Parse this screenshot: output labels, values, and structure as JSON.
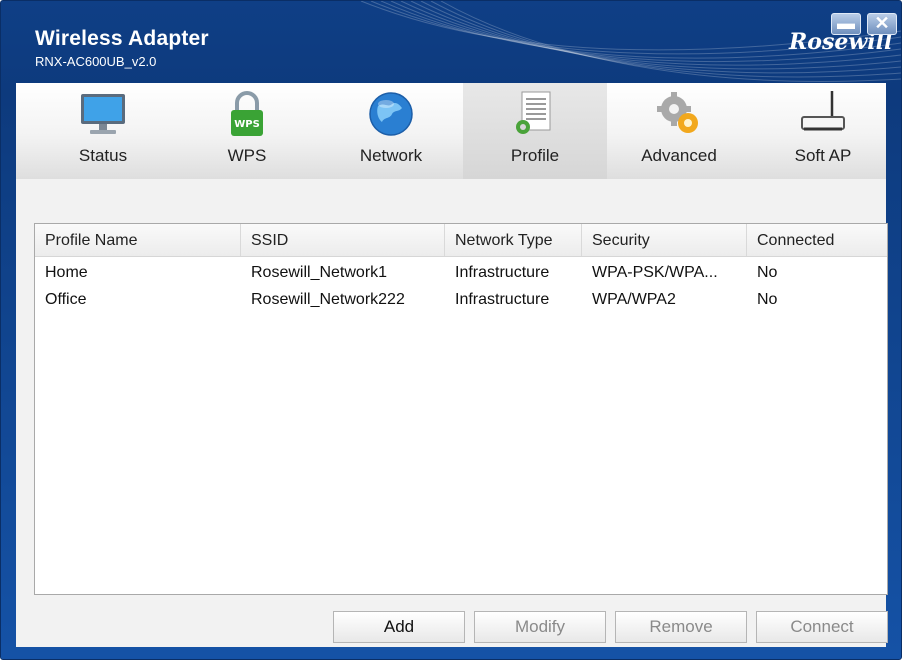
{
  "window": {
    "title": "Wireless Adapter",
    "subtitle": "RNX-AC600UB_v2.0",
    "logo": "Rosewill",
    "minimize_icon": "minimize-icon",
    "close_icon": "close-icon"
  },
  "tabs": [
    {
      "label": "Status",
      "icon": "monitor-icon",
      "active": false
    },
    {
      "label": "WPS",
      "icon": "wps-lock-icon",
      "active": false
    },
    {
      "label": "Network",
      "icon": "globe-icon",
      "active": false
    },
    {
      "label": "Profile",
      "icon": "document-gear-icon",
      "active": true
    },
    {
      "label": "Advanced",
      "icon": "gears-icon",
      "active": false
    },
    {
      "label": "Soft AP",
      "icon": "router-icon",
      "active": false
    }
  ],
  "profile_table": {
    "columns": [
      "Profile Name",
      "SSID",
      "Network Type",
      "Security",
      "Connected"
    ],
    "rows": [
      [
        "Home",
        "Rosewill_Network1",
        "Infrastructure",
        "WPA-PSK/WPA...",
        "No"
      ],
      [
        "Office",
        "Rosewill_Network222",
        "Infrastructure",
        "WPA/WPA2",
        "No"
      ]
    ]
  },
  "buttons": {
    "add": "Add",
    "modify": "Modify",
    "remove": "Remove",
    "connect": "Connect"
  },
  "colors": {
    "title_bar": "#0f3f86",
    "accent": "#1552a6"
  }
}
